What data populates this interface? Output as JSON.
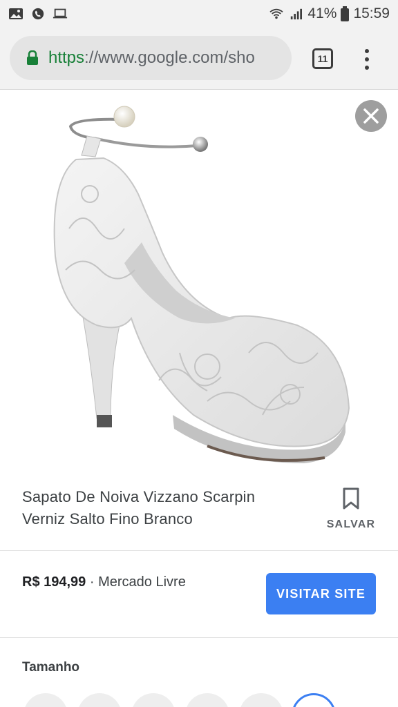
{
  "status_bar": {
    "battery": "41%",
    "time": "15:59",
    "left_icons": [
      "image-icon",
      "phone-icon",
      "laptop-icon"
    ],
    "right_icons": [
      "wifi-icon",
      "signal-icon",
      "battery-icon"
    ]
  },
  "browser": {
    "url_scheme": "https",
    "url_rest": "://www.google.com/sho",
    "tab_count": "11"
  },
  "product": {
    "title": "Sapato De Noiva Vizzano Scarpin Verniz Salto Fino Branco",
    "save_label": "SALVAR",
    "price": "R$ 194,99",
    "separator": "·",
    "seller": "Mercado Livre",
    "visit_label": "VISITAR SITE",
    "size_label": "Tamanho"
  },
  "colors": {
    "accent": "#3b7ff2",
    "lock": "#188038"
  }
}
